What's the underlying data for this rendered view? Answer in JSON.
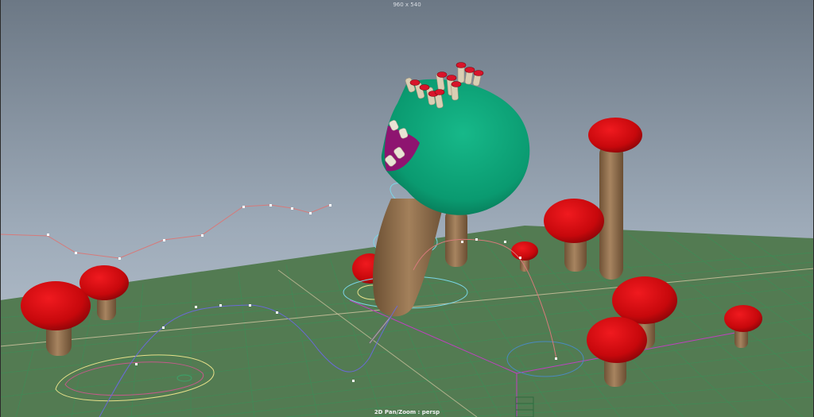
{
  "viewport": {
    "resolution_gate": "960 x 540",
    "camera_status": "2D Pan/Zoom : persp"
  },
  "scene": {
    "objects": [
      "character-head",
      "character-neck",
      "mushrooms",
      "motion-curves",
      "ground-grid",
      "rig-controls"
    ]
  },
  "colors": {
    "sky_top": "#6e7a88",
    "sky_bottom": "#b6c2cf",
    "ground": "#527a52",
    "grid": "#3f8a55",
    "grid_axis": "#c8a26a",
    "mushroom_cap": "#d40b10",
    "mushroom_stem": "#8a6a48",
    "head": "#0c9a72",
    "neck": "#8d6c4a",
    "mouth": "#9a1678",
    "curve_red": "#d67a7a",
    "curve_blue": "#6a6ad6",
    "curve_yellow": "#e6e08a",
    "curve_cyan": "#7ad6e6",
    "curve_magenta": "#c040c0"
  }
}
